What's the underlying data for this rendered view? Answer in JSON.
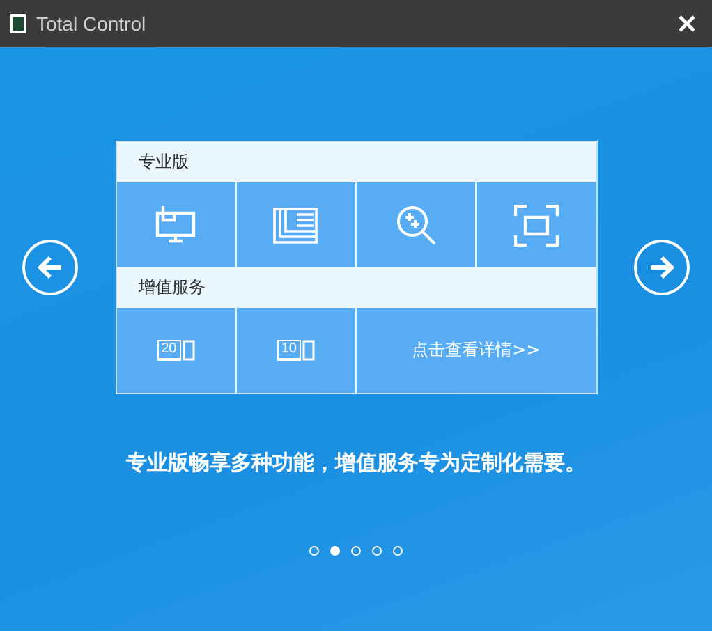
{
  "window": {
    "title": "Total Control"
  },
  "sections": [
    {
      "title": "专业版",
      "tiles": [
        {
          "kind": "remote-desktop"
        },
        {
          "kind": "layout"
        },
        {
          "kind": "zoom"
        },
        {
          "kind": "screen-capture"
        }
      ]
    },
    {
      "title": "增值服务",
      "tiles": [
        {
          "kind": "devices",
          "count": "20"
        },
        {
          "kind": "devices",
          "count": "10"
        },
        {
          "kind": "link",
          "label": "点击查看详情>>"
        }
      ]
    }
  ],
  "caption": "专业版畅享多种功能，增值服务专为定制化需要。",
  "pager": [
    {
      "selected": false
    },
    {
      "selected": true
    },
    {
      "selected": false
    },
    {
      "selected": false
    },
    {
      "selected": false
    }
  ]
}
